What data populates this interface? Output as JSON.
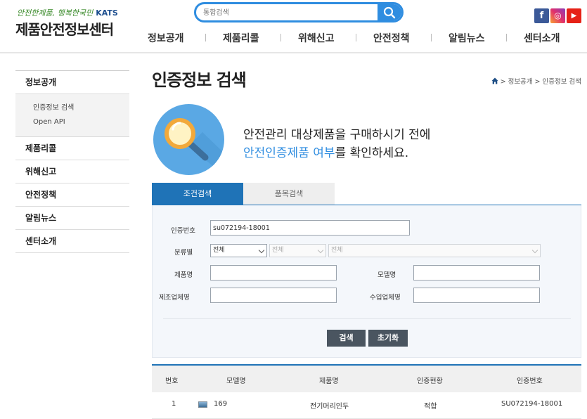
{
  "header": {
    "slogan": "안전한제품, 행복한국민",
    "org_mark": "KATS",
    "site_title": "제품안전정보센터",
    "search_placeholder": "통합검색",
    "sns": [
      {
        "name": "facebook",
        "glyph": "f",
        "color": "#3b5998"
      },
      {
        "name": "instagram",
        "glyph": "◎",
        "color": "#e1306c"
      },
      {
        "name": "youtube",
        "glyph": "▶",
        "color": "#e62117"
      }
    ]
  },
  "gnb": [
    "정보공개",
    "제품리콜",
    "위해신고",
    "안전정책",
    "알림뉴스",
    "센터소개"
  ],
  "sidebar": {
    "active": "정보공개",
    "sub_items": [
      "인증정보 검색",
      "Open API"
    ],
    "items": [
      "제품리콜",
      "위해신고",
      "안전정책",
      "알림뉴스",
      "센터소개"
    ]
  },
  "page": {
    "title": "인증정보 검색",
    "breadcrumb": "> 정보공개 > 인증정보 검색"
  },
  "banner": {
    "line1": "안전관리 대상제품을 구매하시기 전에",
    "line2_highlight": "안전인증제품 여부",
    "line2_rest": "를 확인하세요."
  },
  "tabs": [
    "조건검색",
    "품목검색"
  ],
  "form": {
    "cert_no_label": "인증번호",
    "cert_no_value": "su072194-18001",
    "category_label": "분류별",
    "category_values": [
      "전체",
      "전체",
      "전체"
    ],
    "product_label": "제품명",
    "product_value": "",
    "model_label": "모델명",
    "model_value": "",
    "maker_label": "제조업체명",
    "maker_value": "",
    "importer_label": "수입업체명",
    "importer_value": "",
    "search_button": "검색",
    "reset_button": "초기화"
  },
  "table": {
    "headers": [
      "번호",
      "모델명",
      "제품명",
      "인증현황",
      "인증번호"
    ],
    "rows": [
      {
        "no": "1",
        "model": "169",
        "product": "전기머리인두",
        "status": "적합",
        "cert_no": "SU072194-18001"
      }
    ]
  },
  "colors": {
    "accent": "#2f8de0",
    "tab_active": "#1f73b7",
    "button": "#4a5560"
  }
}
